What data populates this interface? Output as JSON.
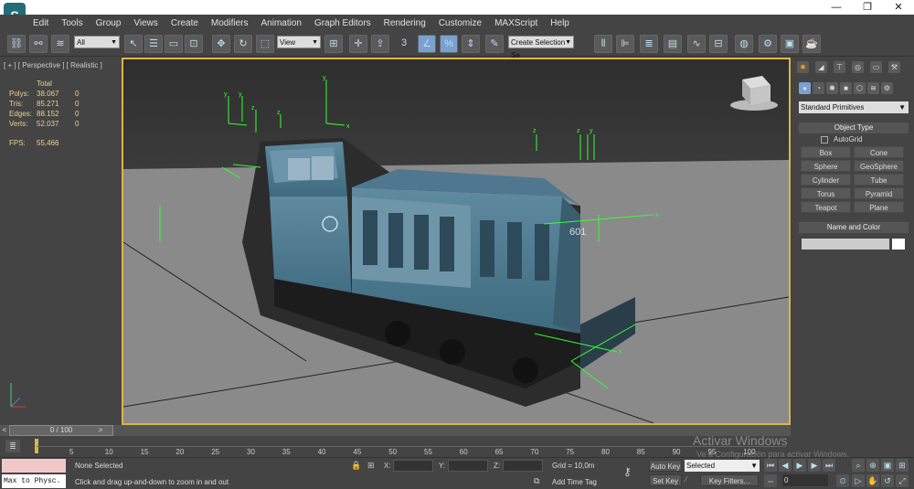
{
  "window": {
    "logo": "S",
    "minimize": "—",
    "maximize": "❐",
    "close": "✕"
  },
  "menu": [
    "Edit",
    "Tools",
    "Group",
    "Views",
    "Create",
    "Modifiers",
    "Animation",
    "Graph Editors",
    "Rendering",
    "Customize",
    "MAXScript",
    "Help"
  ],
  "toolbar": {
    "selection_filter": "All",
    "ref_coord": "View",
    "snap_count": "3",
    "selection_set_placeholder": "Create Selection Se"
  },
  "viewport": {
    "label": "[ + ] [ Perspective ] [ Realistic ]",
    "stats": {
      "header": "Total",
      "rows": [
        {
          "label": "Polys:",
          "total": "38.067",
          "sel": "0"
        },
        {
          "label": "Tris:",
          "total": "85.271",
          "sel": "0"
        },
        {
          "label": "Edges:",
          "total": "88.152",
          "sel": "0"
        },
        {
          "label": "Verts:",
          "total": "52.037",
          "sel": "0"
        }
      ],
      "fps_label": "FPS:",
      "fps_value": "55,466"
    },
    "loco_number": "601",
    "axis_x": "x",
    "axis_y": "y",
    "axis_z": "z"
  },
  "command_panel": {
    "category": "Standard Primitives",
    "object_type_title": "Object Type",
    "autogrid": "AutoGrid",
    "buttons": [
      "Box",
      "Cone",
      "Sphere",
      "GeoSphere",
      "Cylinder",
      "Tube",
      "Torus",
      "Pyramid",
      "Teapot",
      "Plane"
    ],
    "name_color_title": "Name and Color"
  },
  "timeline": {
    "position": "0 / 100",
    "prev": "<",
    "next": ">",
    "ticks": [
      "5",
      "10",
      "15",
      "20",
      "25",
      "30",
      "35",
      "40",
      "45",
      "50",
      "55",
      "60",
      "65",
      "70",
      "75",
      "80",
      "85",
      "90",
      "95",
      "100"
    ]
  },
  "status": {
    "maxscript_input": "Max to Physc.",
    "none_selected": "None Selected",
    "prompt": "Click and drag up-and-down to zoom in and out",
    "x_label": "X:",
    "y_label": "Y:",
    "z_label": "Z:",
    "grid": "Grid = 10,0m",
    "add_time_tag": "Add Time Tag",
    "auto_key": "Auto Key",
    "set_key": "Set Key",
    "key_mode": "Selected",
    "key_filters": "Key Filters...",
    "frame": "0"
  },
  "watermark": {
    "line1": "Activar Windows",
    "line2": "Ve a Configuración para activar Windows."
  }
}
